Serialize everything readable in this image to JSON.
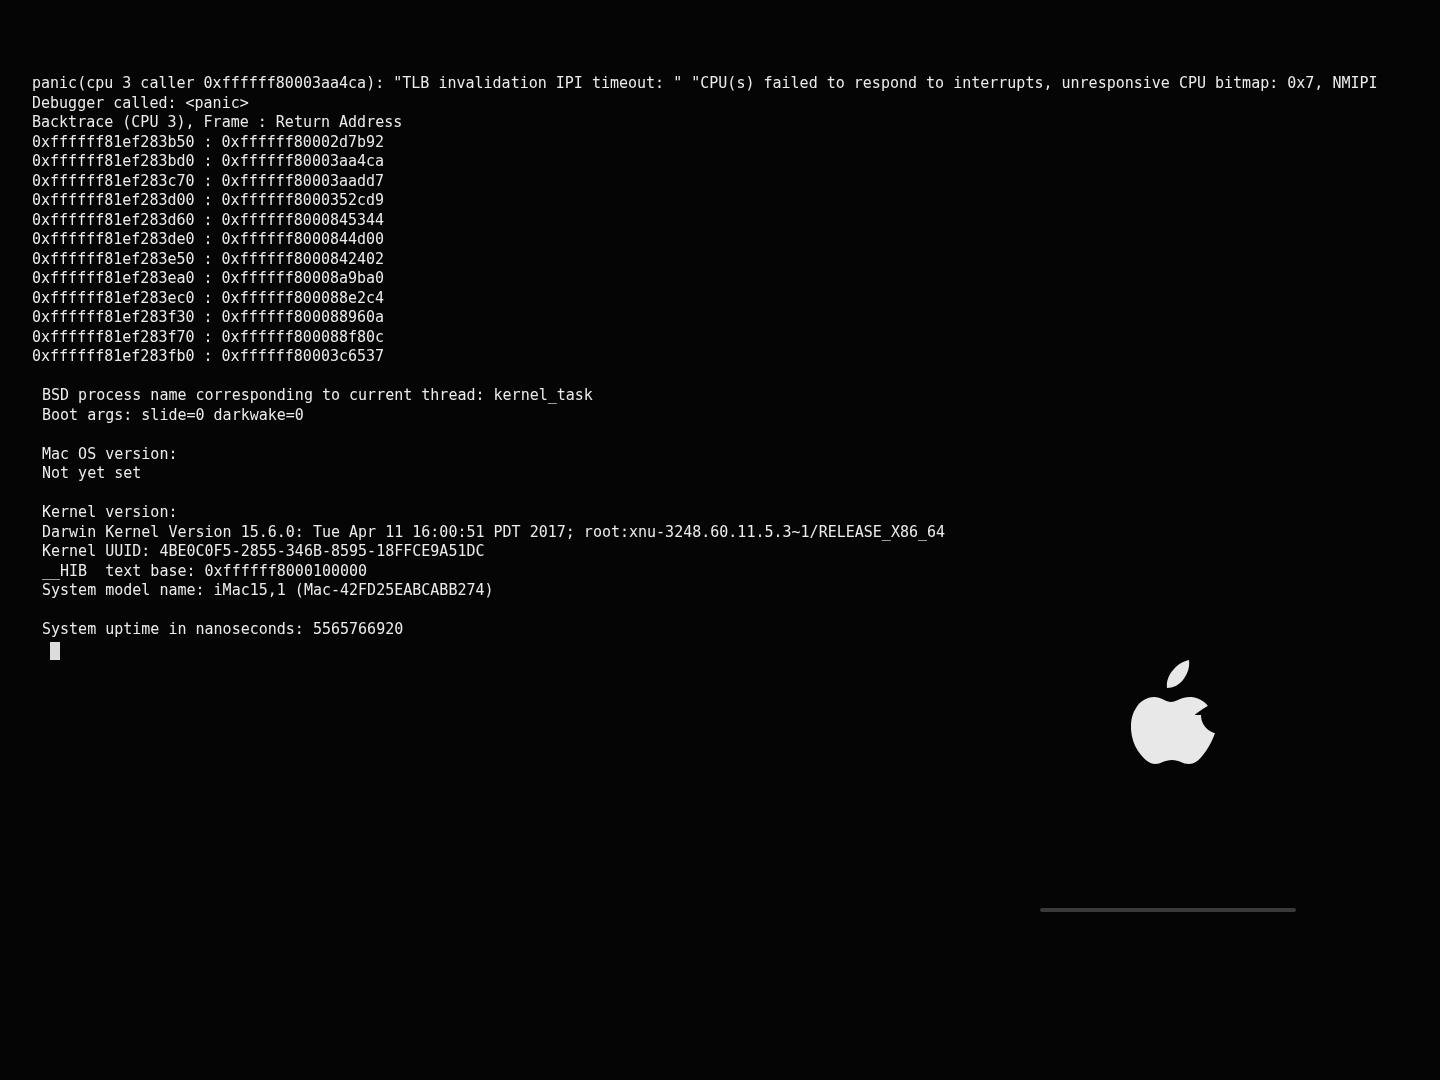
{
  "panic_log": {
    "header": [
      "panic(cpu 3 caller 0xffffff80003aa4ca): \"TLB invalidation IPI timeout: \" \"CPU(s) failed to respond to interrupts, unresponsive CPU bitmap: 0x7, NMIPI",
      "Debugger called: <panic>",
      "Backtrace (CPU 3), Frame : Return Address"
    ],
    "backtrace": [
      {
        "frame": "0xffffff81ef283b50",
        "separator": ":",
        "return_address": "0xffffff80002d7b92"
      },
      {
        "frame": "0xffffff81ef283bd0",
        "separator": ":",
        "return_address": "0xffffff80003aa4ca"
      },
      {
        "frame": "0xffffff81ef283c70",
        "separator": ":",
        "return_address": "0xffffff80003aadd7"
      },
      {
        "frame": "0xffffff81ef283d00",
        "separator": ":",
        "return_address": "0xffffff8000352cd9"
      },
      {
        "frame": "0xffffff81ef283d60",
        "separator": ":",
        "return_address": "0xffffff8000845344"
      },
      {
        "frame": "0xffffff81ef283de0",
        "separator": ":",
        "return_address": "0xffffff8000844d00"
      },
      {
        "frame": "0xffffff81ef283e50",
        "separator": ":",
        "return_address": "0xffffff8000842402"
      },
      {
        "frame": "0xffffff81ef283ea0",
        "separator": ":",
        "return_address": "0xffffff80008a9ba0"
      },
      {
        "frame": "0xffffff81ef283ec0",
        "separator": ":",
        "return_address": "0xffffff800088e2c4"
      },
      {
        "frame": "0xffffff81ef283f30",
        "separator": ":",
        "return_address": "0xffffff800088960a"
      },
      {
        "frame": "0xffffff81ef283f70",
        "separator": ":",
        "return_address": "0xffffff800088f80c"
      },
      {
        "frame": "0xffffff81ef283fb0",
        "separator": ":",
        "return_address": "0xffffff80003c6537"
      }
    ],
    "blocks": [
      [
        "BSD process name corresponding to current thread: kernel_task",
        "Boot args: slide=0 darkwake=0"
      ],
      [
        "Mac OS version:",
        "Not yet set"
      ],
      [
        "Kernel version:",
        "Darwin Kernel Version 15.6.0: Tue Apr 11 16:00:51 PDT 2017; root:xnu-3248.60.11.5.3~1/RELEASE_X86_64",
        "Kernel UUID: 4BE0C0F5-2855-346B-8595-18FFCE9A51DC",
        "__HIB  text base: 0xffffff8000100000",
        "System model name: iMac15,1 (Mac-42FD25EABCABB274)"
      ],
      [
        "System uptime in nanoseconds: 5565766920"
      ]
    ]
  }
}
